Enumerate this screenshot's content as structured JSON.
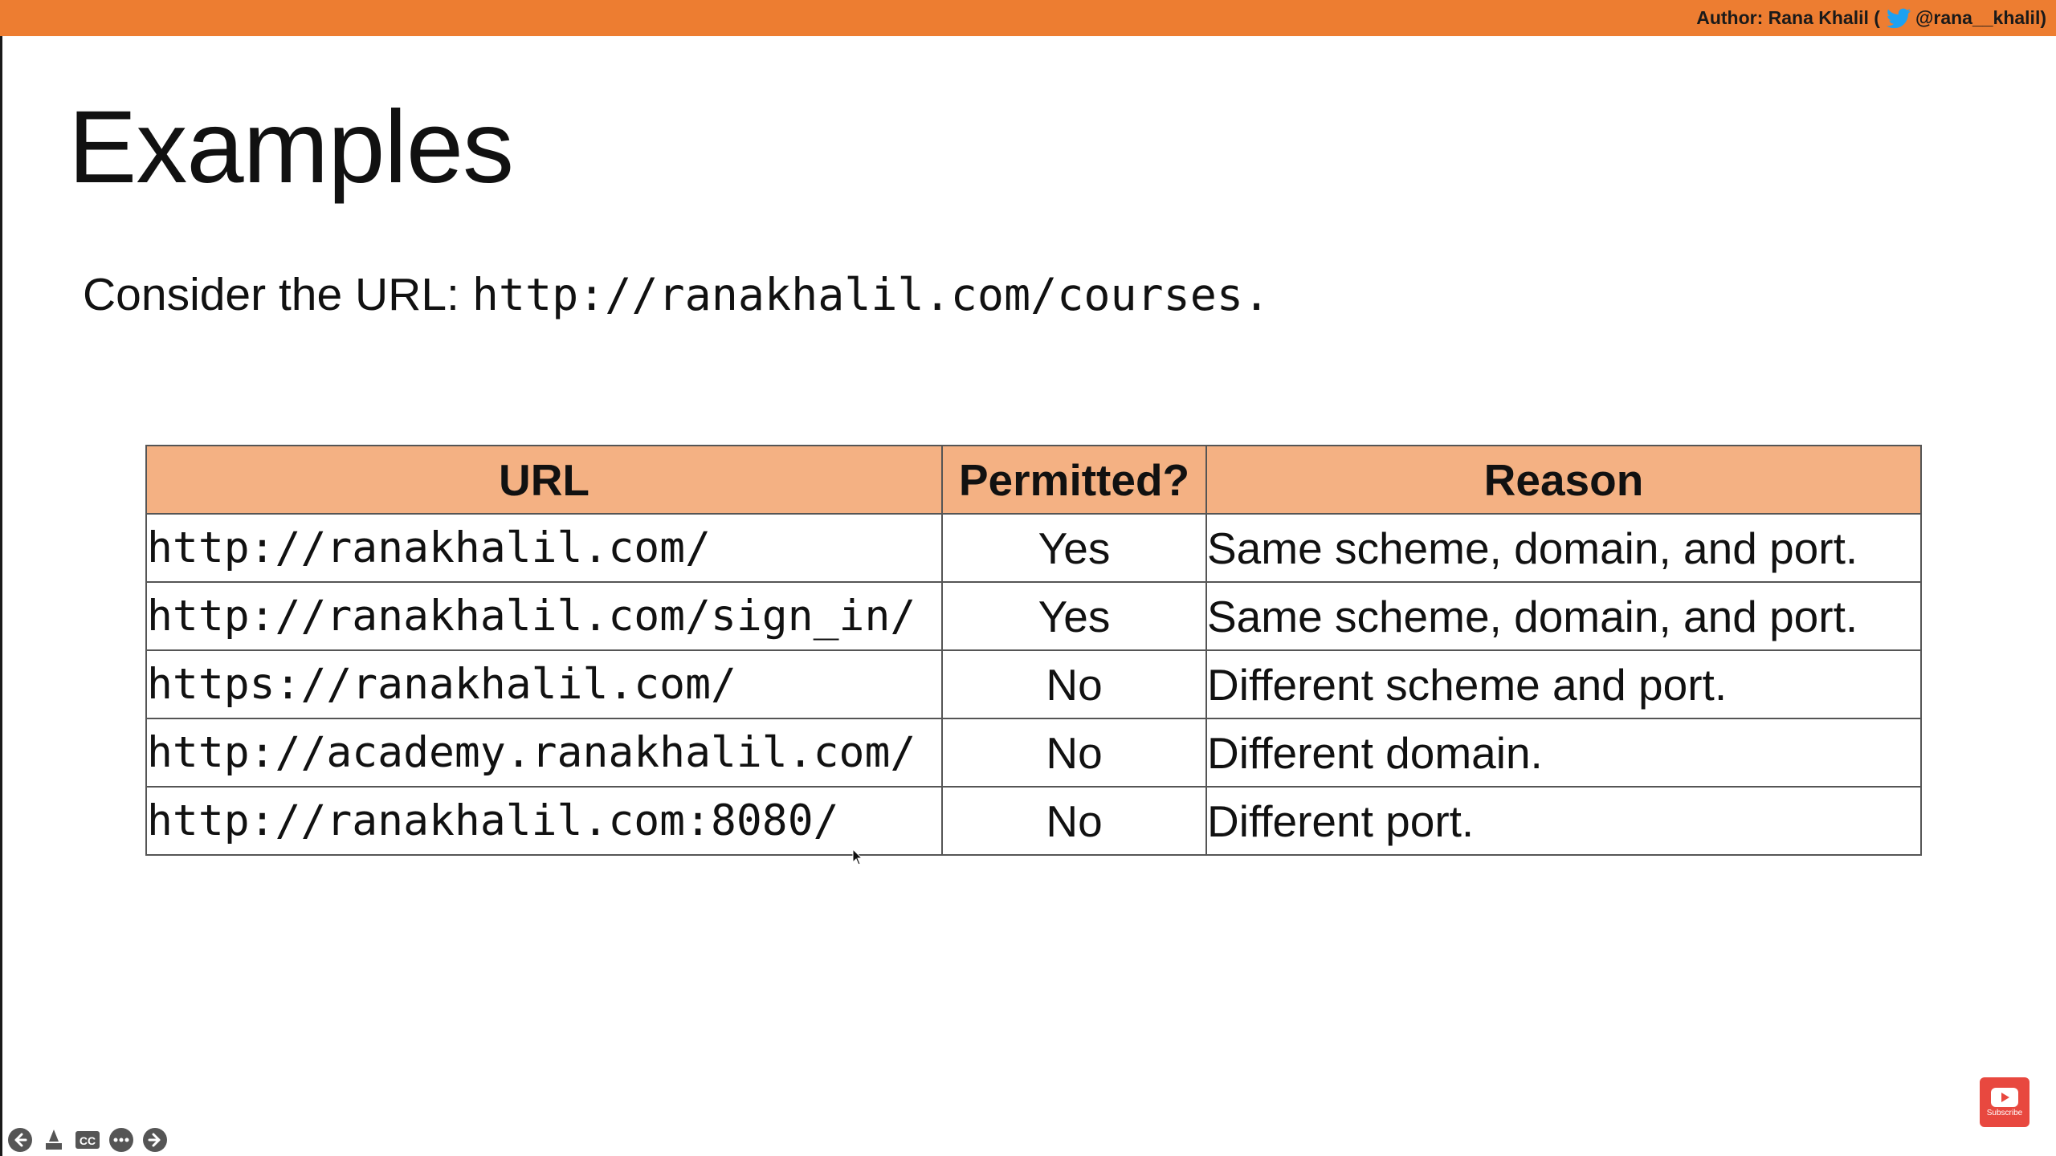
{
  "header": {
    "author_prefix": "Author: Rana Khalil (",
    "author_handle": "@rana__khalil)",
    "bar_color": "#ED7D31"
  },
  "slide": {
    "title": "Examples",
    "consider_text": "Consider the URL: ",
    "consider_url": "http://ranakhalil.com/courses."
  },
  "table": {
    "header_color": "#F4B183",
    "columns": [
      "URL",
      "Permitted?",
      "Reason"
    ],
    "rows": [
      {
        "url": "http://ranakhalil.com/",
        "permitted": "Yes",
        "reason": "Same scheme, domain, and port."
      },
      {
        "url": "http://ranakhalil.com/sign_in/",
        "permitted": "Yes",
        "reason": "Same scheme, domain, and port."
      },
      {
        "url": "https://ranakhalil.com/",
        "permitted": "No",
        "reason": "Different scheme and port."
      },
      {
        "url": "http://academy.ranakhalil.com/",
        "permitted": "No",
        "reason": "Different domain."
      },
      {
        "url": "http://ranakhalil.com:8080/",
        "permitted": "No",
        "reason": "Different port."
      }
    ]
  },
  "controls": {
    "icons": [
      "previous-icon",
      "pointer-icon",
      "cc-icon",
      "more-icon",
      "next-icon"
    ],
    "cc_label": "CC"
  },
  "subscribe": {
    "label": "Subscribe",
    "icon": "youtube-play-icon",
    "color": "#E8483F"
  }
}
